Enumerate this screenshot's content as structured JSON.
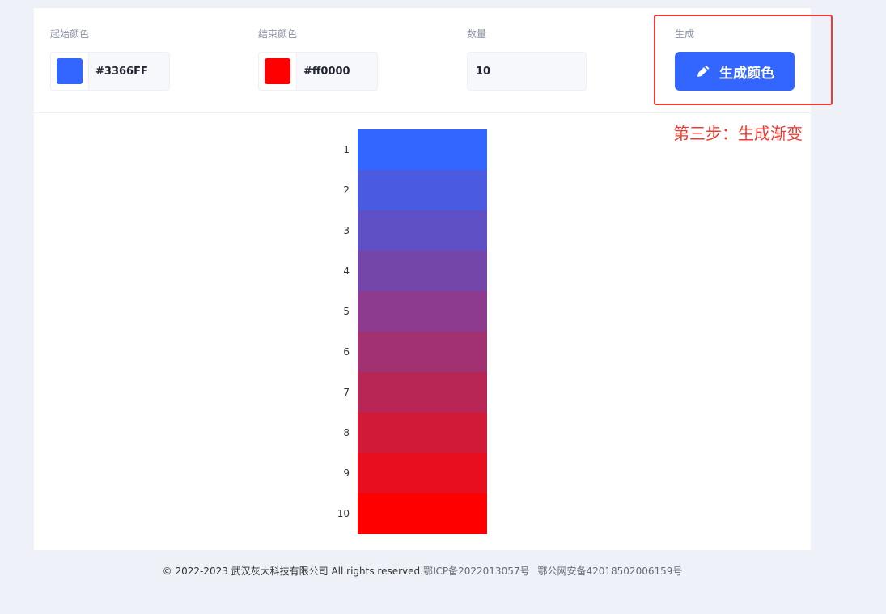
{
  "controls": {
    "start_color": {
      "label": "起始颜色",
      "value": "#3366FF",
      "swatch": "#3366ff"
    },
    "end_color": {
      "label": "结束颜色",
      "value": "#ff0000",
      "swatch": "#ff0000"
    },
    "count": {
      "label": "数量",
      "value": "10"
    },
    "generate": {
      "label": "生成",
      "button_label": "生成颜色",
      "icon": "pencil-icon"
    }
  },
  "annotation": {
    "text": "第三步：生成渐变",
    "color": "#f2382f"
  },
  "gradient": {
    "items": [
      {
        "index": "1",
        "color": "#3366ff"
      },
      {
        "index": "2",
        "color": "#4a5be2"
      },
      {
        "index": "3",
        "color": "#5f50c6"
      },
      {
        "index": "4",
        "color": "#7546aa"
      },
      {
        "index": "5",
        "color": "#8c3b8e"
      },
      {
        "index": "6",
        "color": "#a23172"
      },
      {
        "index": "7",
        "color": "#b82656"
      },
      {
        "index": "8",
        "color": "#d01a37"
      },
      {
        "index": "9",
        "color": "#e80e1f"
      },
      {
        "index": "10",
        "color": "#ff0000"
      }
    ]
  },
  "footer": {
    "copyright": "© 2022-2023 武汉灰大科技有限公司 All rights reserved.",
    "icp": "鄂ICP备2022013057号",
    "police": "鄂公网安备42018502006159号"
  }
}
